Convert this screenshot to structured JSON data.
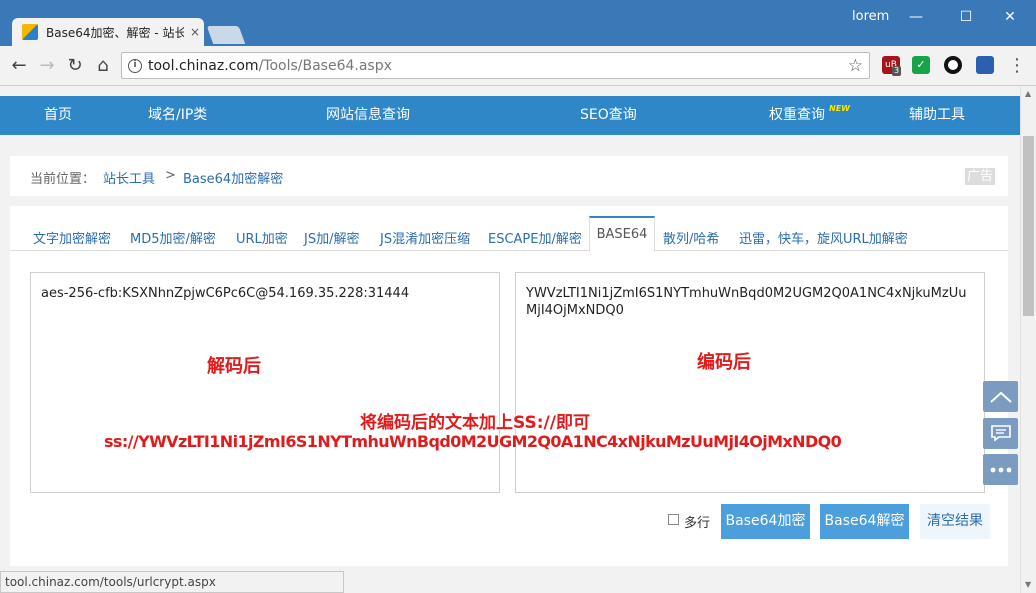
{
  "browser": {
    "tab_title": "Base64加密、解密 - 站长",
    "tab_close": "×",
    "user": "lorem",
    "window_controls": {
      "minimize": "—",
      "maximize": "☐",
      "close": "✕"
    },
    "url_host": "tool.chinaz.com",
    "url_path": "/Tools/Base64.aspx",
    "status_url": "tool.chinaz.com/tools/urlcrypt.aspx",
    "ext_badge": "3"
  },
  "nav": {
    "items": [
      "首页",
      "域名/IP类",
      "网站信息查询",
      "SEO查询",
      "权重查询",
      "辅助工具"
    ],
    "new_badge": "NEW"
  },
  "breadcrumb": {
    "label": "当前位置：",
    "home": "站长工具",
    "sep": ">",
    "current": "Base64加密解密",
    "ad": "广告"
  },
  "tabs": {
    "items": [
      "文字加密解密",
      "MD5加密/解密",
      "URL加密",
      "JS加/解密",
      "JS混淆加密压缩",
      "ESCAPE加/解密",
      "BASE64",
      "散列/哈希",
      "迅雷，快车，旋风URL加解密"
    ],
    "active": "BASE64"
  },
  "input_text": "aes-256-cfb:KSXNhnZpjwC6Pc6C@54.169.35.228:31444",
  "output_text": "YWVzLTI1Ni1jZmI6S1NYTmhuWnBqd0M2UGM2Q0A1NC4xNjkuMzUuMjI4OjMxNDQ0",
  "annotations": {
    "decoded": "解码后",
    "encoded": "编码后",
    "hint": "将编码后的文本加上SS://即可",
    "ss_link": "ss://YWVzLTI1Ni1jZmI6S1NYTmhuWnBqd0M2UGM2Q0A1NC4xNjkuMzUuMjI4OjMxNDQ0"
  },
  "controls": {
    "multiline_label": "多行",
    "encode_button": "Base64加密",
    "decode_button": "Base64解密",
    "clear_button": "清空结果"
  },
  "colors": {
    "nav_bg": "#2f87c8",
    "button_bg": "#4a9fdc",
    "annotation": "#e01b1b",
    "chrome_bar": "#3a78b7"
  }
}
